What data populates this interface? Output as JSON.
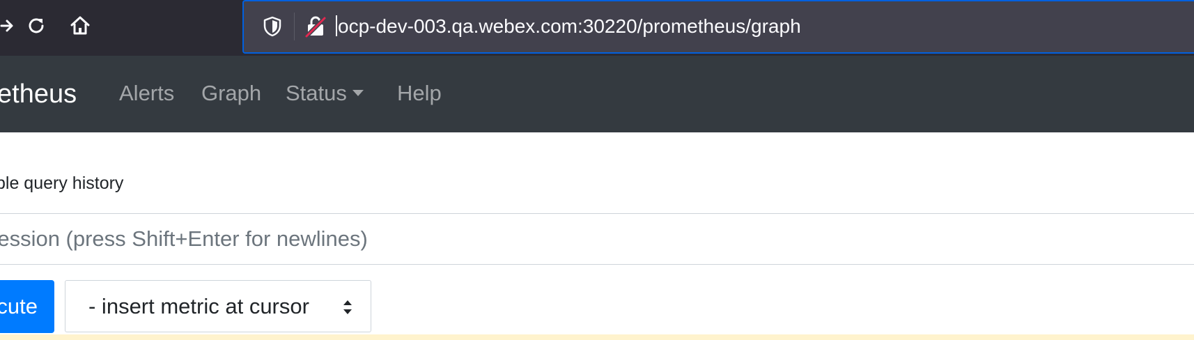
{
  "browser": {
    "url": "ocp-dev-003.qa.webex.com:30220/prometheus/graph",
    "icons": [
      "arrow-right-icon",
      "reload-icon",
      "home-icon",
      "shield-icon",
      "insecure-lock-icon"
    ]
  },
  "navbar": {
    "brand": "etheus",
    "links": {
      "alerts": "Alerts",
      "graph": "Graph",
      "status": "Status",
      "help": "Help"
    }
  },
  "query": {
    "history_label": "ble query history",
    "expression_placeholder": "ression (press Shift+Enter for newlines)"
  },
  "actions": {
    "execute_label": "cute",
    "metric_select_label": "- insert metric at cursor"
  },
  "colors": {
    "navbar_bg": "#343a40",
    "primary": "#007bff",
    "url_focus": "#0060df"
  }
}
